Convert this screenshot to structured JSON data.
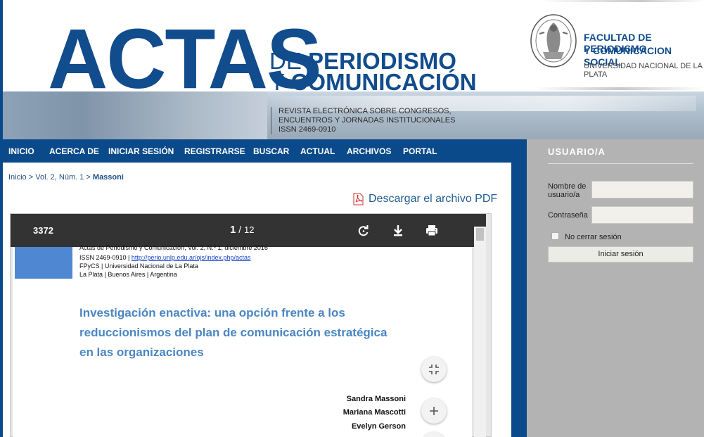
{
  "header": {
    "brand_big": "ACTAS",
    "brand_sub1_thin": "DE ",
    "brand_sub1_bold": "PERIODISMO",
    "brand_sub2_thin": "Y ",
    "brand_sub2_bold": "COMUNICACIÓN",
    "tagline": [
      "REVISTA ELECTRÓNICA SOBRE CONGRESOS,",
      "ENCUENTROS Y JORNADAS INSTITUCIONALES",
      "ISSN 2469-0910"
    ],
    "faculty_line1": "FACULTAD DE PERIODISMO",
    "faculty_line2": "Y COMUNICACION SOCIAL",
    "university": "UNIVERSIDAD NACIONAL DE LA PLATA",
    "seal_icon": "university-seal-icon"
  },
  "nav": {
    "items": [
      "INICIO",
      "ACERCA DE",
      "INICIAR SESIÓN",
      "REGISTRARSE",
      "BUSCAR",
      "ACTUAL",
      "ARCHIVOS",
      "PORTAL"
    ]
  },
  "breadcrumb": {
    "home": "Inicio",
    "sep": ">",
    "issue": "Vol. 2, Núm. 1",
    "current": "Massoni"
  },
  "download": {
    "label": "Descargar el archivo PDF",
    "icon": "pdf-icon"
  },
  "viewer": {
    "doc_id": "3372",
    "current_page": "1",
    "page_sep": "/",
    "total_pages": "12",
    "toolbar_icons": [
      "rotate-icon",
      "download-icon",
      "print-icon"
    ],
    "page": {
      "meta": [
        "Actas de Periodismo y Comunicación, Vol. 2, N.º 1, diciembre 2016",
        "ISSN 2469-0910 | ",
        "FPyCS | Universidad Nacional de La Plata",
        "La Plata | Buenos Aires | Argentina"
      ],
      "meta_link": "http://perio.unlp.edu.ar/ojs/index.php/actas",
      "title_lines": [
        "Investigación enactiva: una opción frente a los",
        "reduccionismos del plan de comunicación estratégica",
        "en las organizaciones"
      ],
      "authors": [
        "Sandra Massoni",
        "Mariana Mascotti",
        "Evelyn Gerson"
      ]
    },
    "fab_icons": [
      "collapse-icon",
      "zoom-in-icon"
    ]
  },
  "sidebar": {
    "title": "USUARIO/A",
    "username_label_1": "Nombre de",
    "username_label_2": "usuario/a",
    "password_label": "Contraseña",
    "remember_label": "No cerrar sesión",
    "login_button": "Iniciar sesión"
  },
  "colors": {
    "brand_blue": "#114c8d",
    "nav_blue": "#0b4a8a",
    "sidebar_gray": "#b3b3b3",
    "title_blue": "#4a86c3"
  }
}
